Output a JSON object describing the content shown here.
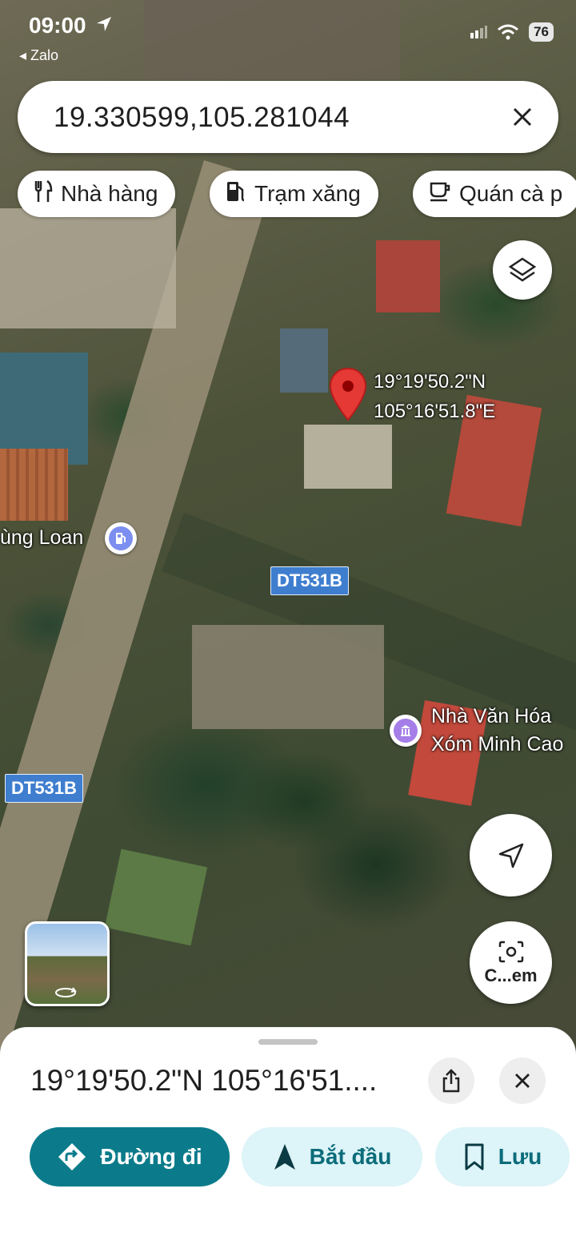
{
  "status_bar": {
    "time": "09:00",
    "back_app": "◂ Zalo",
    "battery": "76"
  },
  "search": {
    "value": "19.330599,105.281044"
  },
  "chips": [
    {
      "label": "Nhà hàng",
      "icon": "restaurant-icon"
    },
    {
      "label": "Trạm xăng",
      "icon": "gas-station-icon"
    },
    {
      "label": "Quán cà p",
      "icon": "coffee-icon"
    }
  ],
  "map": {
    "pin_label_lat": "19°19'50.2\"N",
    "pin_label_lng": "105°16'51.8\"E",
    "road_label_1": "DT531B",
    "road_label_2": "DT531B",
    "poi_gas_label": "ùng Loan",
    "poi_culture_line1": "Nhà Văn Hóa",
    "poi_culture_line2": "Xóm Minh Cao",
    "camera_button_label": "C...em"
  },
  "sheet": {
    "title": "19°19'50.2\"N 105°16'51....",
    "directions_label": "Đường đi",
    "start_label": "Bắt đầu",
    "save_label": "Lưu"
  },
  "colors": {
    "accent_teal": "#0b7b8b",
    "light_teal_button": "#ddf4f8",
    "pin_red": "#e53935",
    "road_label_blue": "#3f7ecf"
  }
}
